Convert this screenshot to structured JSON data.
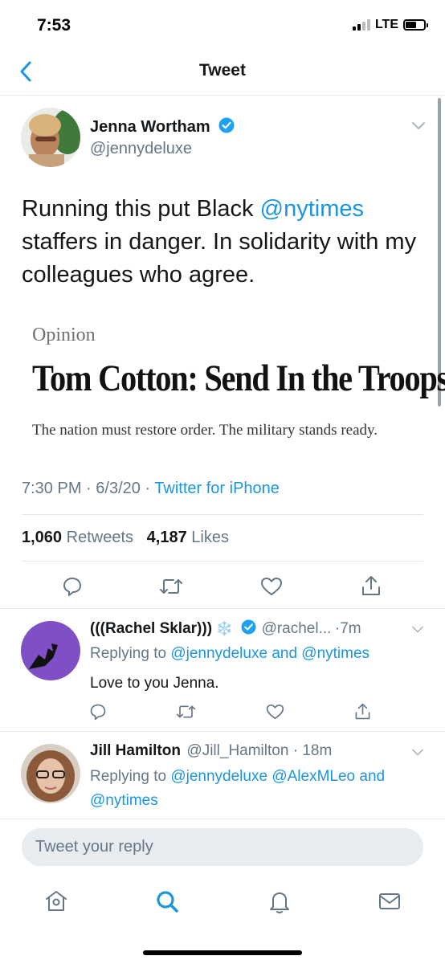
{
  "status_bar": {
    "time": "7:53",
    "network": "LTE"
  },
  "nav": {
    "title": "Tweet"
  },
  "tweet": {
    "author_name": "Jenna Wortham",
    "handle": "@jennydeluxe",
    "text_before": "Running this put Black ",
    "text_mention": "@nytimes",
    "text_after": " staffers in danger. In solidarity with my colleagues who agree.",
    "image": {
      "kicker": "Opinion",
      "headline": "Tom Cotton: Send In the Troops",
      "dek": "The nation must restore order. The military stands ready."
    },
    "time": "7:30 PM",
    "date": "6/3/20",
    "source": "Twitter for iPhone",
    "retweets_count": "1,060",
    "retweets_label": "Retweets",
    "likes_count": "4,187",
    "likes_label": "Likes"
  },
  "replies": [
    {
      "name": "(((Rachel Sklar)))",
      "emoji": "❄️",
      "handle": "@rachel...",
      "age": "7m",
      "replying_label": "Replying to ",
      "replying_to": "@jennydeluxe and @nytimes",
      "text": "Love to you Jenna."
    },
    {
      "name": "Jill Hamilton",
      "handle": "@Jill_Hamilton",
      "age": "18m",
      "replying_label": "Replying to ",
      "replying_to_line1": "@jennydeluxe @AlexMLeo and",
      "replying_to_line2": "@nytimes"
    }
  ],
  "compose": {
    "placeholder": "Tweet your reply"
  },
  "colors": {
    "accent": "#1b95e0",
    "verified": "#1da1f2",
    "secondary": "#657786"
  }
}
